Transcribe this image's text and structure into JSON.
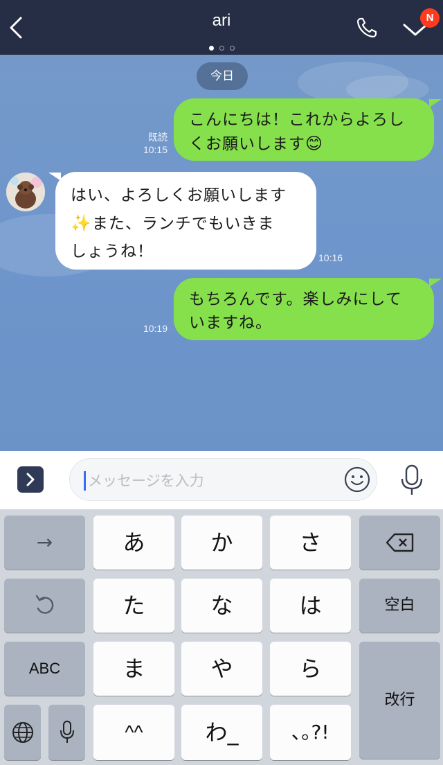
{
  "header": {
    "title": "ari",
    "badge": "N"
  },
  "chat": {
    "date_label": "今日",
    "messages": [
      {
        "direction": "out",
        "lines": [
          "こんにちは！これからよろし",
          "くお願いします"
        ],
        "emoji": "😊",
        "read_label": "既読",
        "time": "10:15"
      },
      {
        "direction": "in",
        "lines": [
          "はい、よろしくお願いします",
          "また、ランチでもいきま",
          "しょうね！"
        ],
        "emoji": "✨",
        "time": "10:16"
      },
      {
        "direction": "out",
        "lines": [
          "もちろんです。楽しみにして",
          "いますね。"
        ],
        "time": "10:19"
      }
    ]
  },
  "input": {
    "placeholder": "メッセージを入力"
  },
  "keyboard": {
    "row1": [
      "→",
      "あ",
      "か",
      "さ",
      "⌫"
    ],
    "row2": [
      "↺",
      "た",
      "な",
      "は",
      "空白"
    ],
    "row3": [
      "ABC",
      "ま",
      "や",
      "ら",
      "改行"
    ],
    "row4": [
      "🌐",
      "🎤",
      "^^",
      "わ_",
      "､｡?!"
    ]
  },
  "colors": {
    "header_bg": "#262e45",
    "chat_bg": "#7098cb",
    "outgoing_bubble": "#86e04c",
    "incoming_bubble": "#ffffff",
    "badge": "#ff3b1f",
    "keyboard_bg": "#d1d5dc"
  },
  "icons": {
    "back": "chevron-left-icon",
    "call": "phone-icon",
    "menu": "chevron-down-icon",
    "expand": "chevron-right-icon",
    "emoji": "smiley-icon",
    "mic": "microphone-icon"
  }
}
